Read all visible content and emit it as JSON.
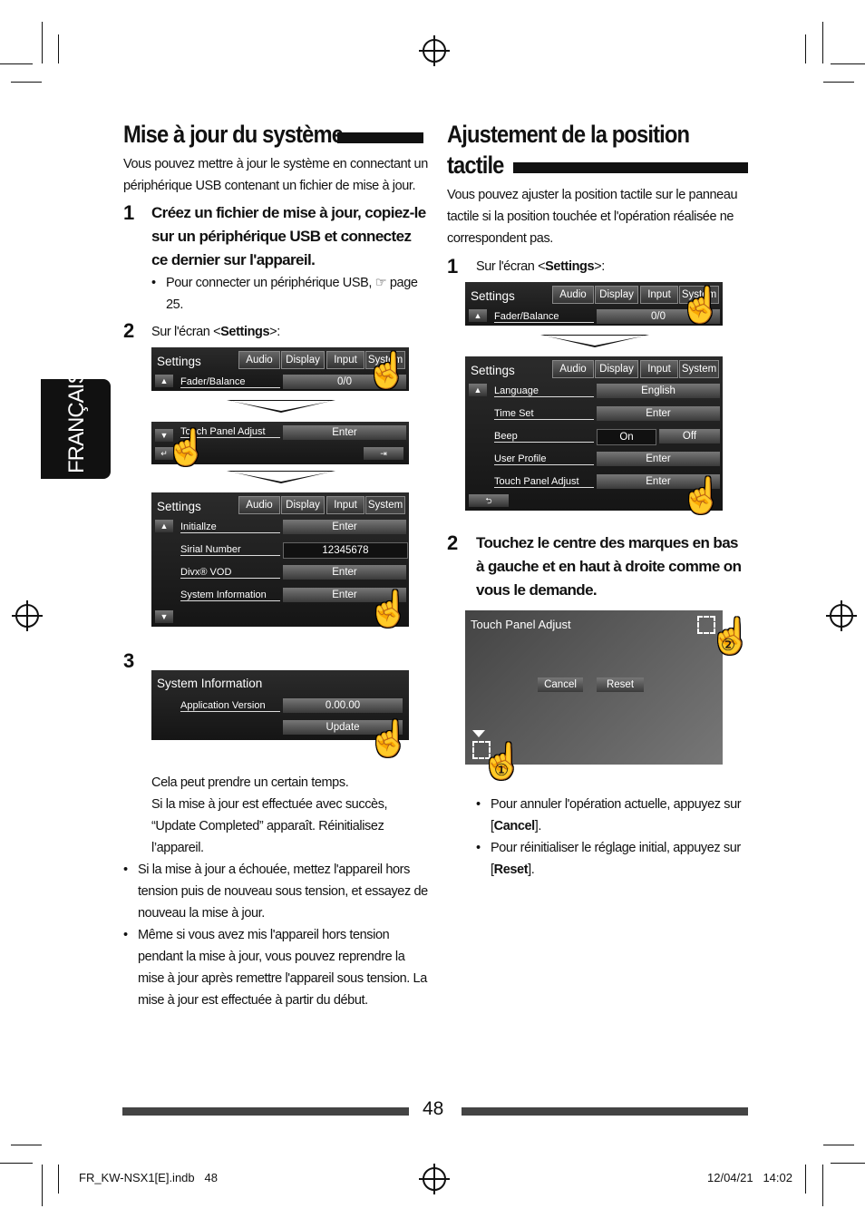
{
  "side_tab": "FRANÇAIS",
  "left": {
    "title": "Mise à jour du système",
    "intro": "Vous pouvez mettre à jour le système en connectant un périphérique USB contenant un fichier de mise à jour.",
    "step1_num": "1",
    "step1": "Créez un fichier de mise à jour, copiez-le sur un périphérique USB et connectez ce dernier sur l'appareil.",
    "step1_bullet": "Pour connecter un périphérique USB, ☞ page 25.",
    "step2_num": "2",
    "step2_pre": "Sur l'écran <",
    "step2_bold": "Settings",
    "step2_post": ">:",
    "step3_num": "3",
    "after3_line1": "Cela peut prendre un certain temps.",
    "after3_line2": "Si la mise à jour est effectuée avec succès, “Update Completed” apparaît. Réinitialisez l’appareil.",
    "bullets": [
      "Si la mise à jour a échouée, mettez l'appareil hors tension puis de nouveau sous tension, et essayez de nouveau la mise à jour.",
      "Même si vous avez mis l'appareil hors tension pendant la mise à jour, vous pouvez reprendre la mise à jour après remettre l'appareil sous tension. La mise à jour est effectuée à partir du début."
    ]
  },
  "right": {
    "title_line1": "Ajustement de la position",
    "title_line2": "tactile",
    "intro": "Vous pouvez ajuster la position tactile sur le panneau tactile si la position touchée et l'opération réalisée ne correspondent pas.",
    "step1_num": "1",
    "step1_pre": "Sur l'écran <",
    "step1_bold": "Settings",
    "step1_post": ">:",
    "step2_num": "2",
    "step2": "Touchez le centre des marques en bas à gauche et en haut à droite comme on vous le demande.",
    "bullet1_pre": "Pour annuler l'opération actuelle, appuyez sur [",
    "bullet1_bold": "Cancel",
    "bullet1_post": "].",
    "bullet2_pre": "Pour réinitialiser le réglage initial, appuyez sur [",
    "bullet2_bold": "Reset",
    "bullet2_post": "]."
  },
  "screens": {
    "title": "Settings",
    "tabs": [
      "Audio",
      "Display",
      "Input",
      "System"
    ],
    "fader": {
      "label": "Fader/Balance",
      "value": "0/0"
    },
    "tpa": {
      "label": "Touch Panel Adjust",
      "value": "Enter"
    },
    "system_rows": [
      {
        "label": "Initiallze",
        "value": "Enter"
      },
      {
        "label": "Sirial Number",
        "value": "12345678"
      },
      {
        "label": "Divx® VOD",
        "value": "Enter"
      },
      {
        "label": "System Information",
        "value": "Enter"
      }
    ],
    "sysinfo": {
      "title": "System Information",
      "label": "Application Version",
      "value": "0.00.00",
      "button": "Update"
    },
    "system_rows2": [
      {
        "label": "Language",
        "value": "English"
      },
      {
        "label": "Time Set",
        "value": "Enter"
      },
      {
        "label": "Beep",
        "value": "On",
        "value2": "Off"
      },
      {
        "label": "User Profile",
        "value": "Enter"
      },
      {
        "label": "Touch Panel Adjust",
        "value": "Enter"
      }
    ],
    "adjust": {
      "title": "Touch Panel Adjust",
      "cancel": "Cancel",
      "reset": "Reset",
      "mark1": "①",
      "mark2": "②"
    }
  },
  "footer": {
    "page": "48",
    "file": "FR_KW-NSX1[E].indb   48",
    "date": "12/04/21   14:02"
  }
}
